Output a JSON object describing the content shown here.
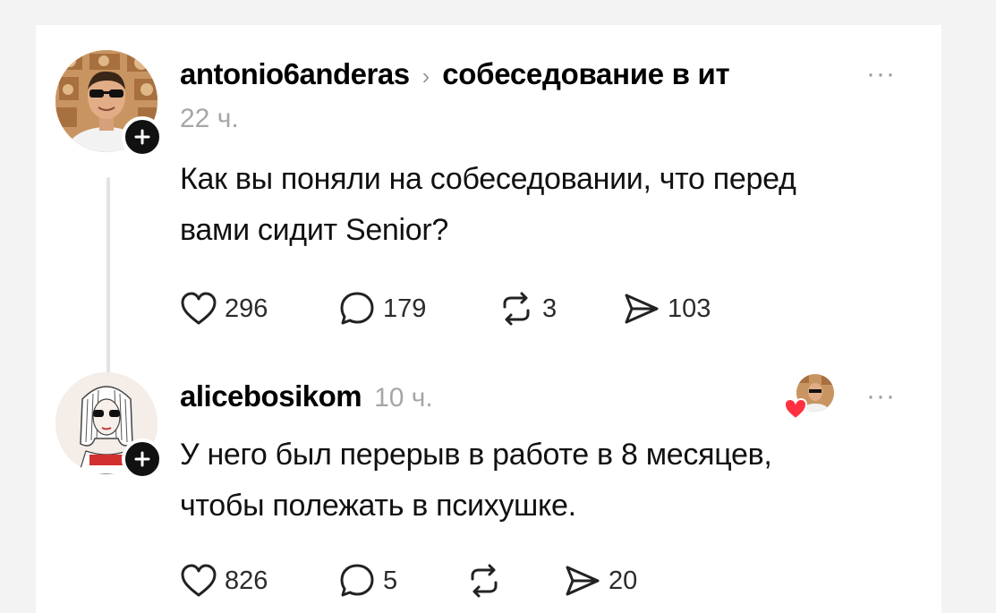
{
  "post": {
    "username": "antonio6anderas",
    "topic": "собеседование в ит",
    "time": "22 ч.",
    "more": "···",
    "text_line1": "Как вы поняли на собеседовании, что перед",
    "text_line2": "вами сидит Senior?",
    "likes": "296",
    "replies": "179",
    "reposts": "3",
    "shares": "103"
  },
  "reply": {
    "username": "alicebosikom",
    "time": "10 ч.",
    "more": "···",
    "text_line1": "У него был перерыв в работе в 8 месяцев,",
    "text_line2": "чтобы полежать в психушке.",
    "likes": "826",
    "replies": "5",
    "reposts": "",
    "shares": "20"
  },
  "icons": {
    "like": "heart-outline-icon",
    "reply": "speech-bubble-icon",
    "repost": "repost-arrows-icon",
    "share": "paper-plane-icon",
    "follow": "plus-icon",
    "liked_by_author": "heart-filled-icon"
  },
  "colors": {
    "background": "#ffffff",
    "text": "#000000",
    "muted": "#a6a6a6",
    "heart_badge": "#ff3040"
  }
}
